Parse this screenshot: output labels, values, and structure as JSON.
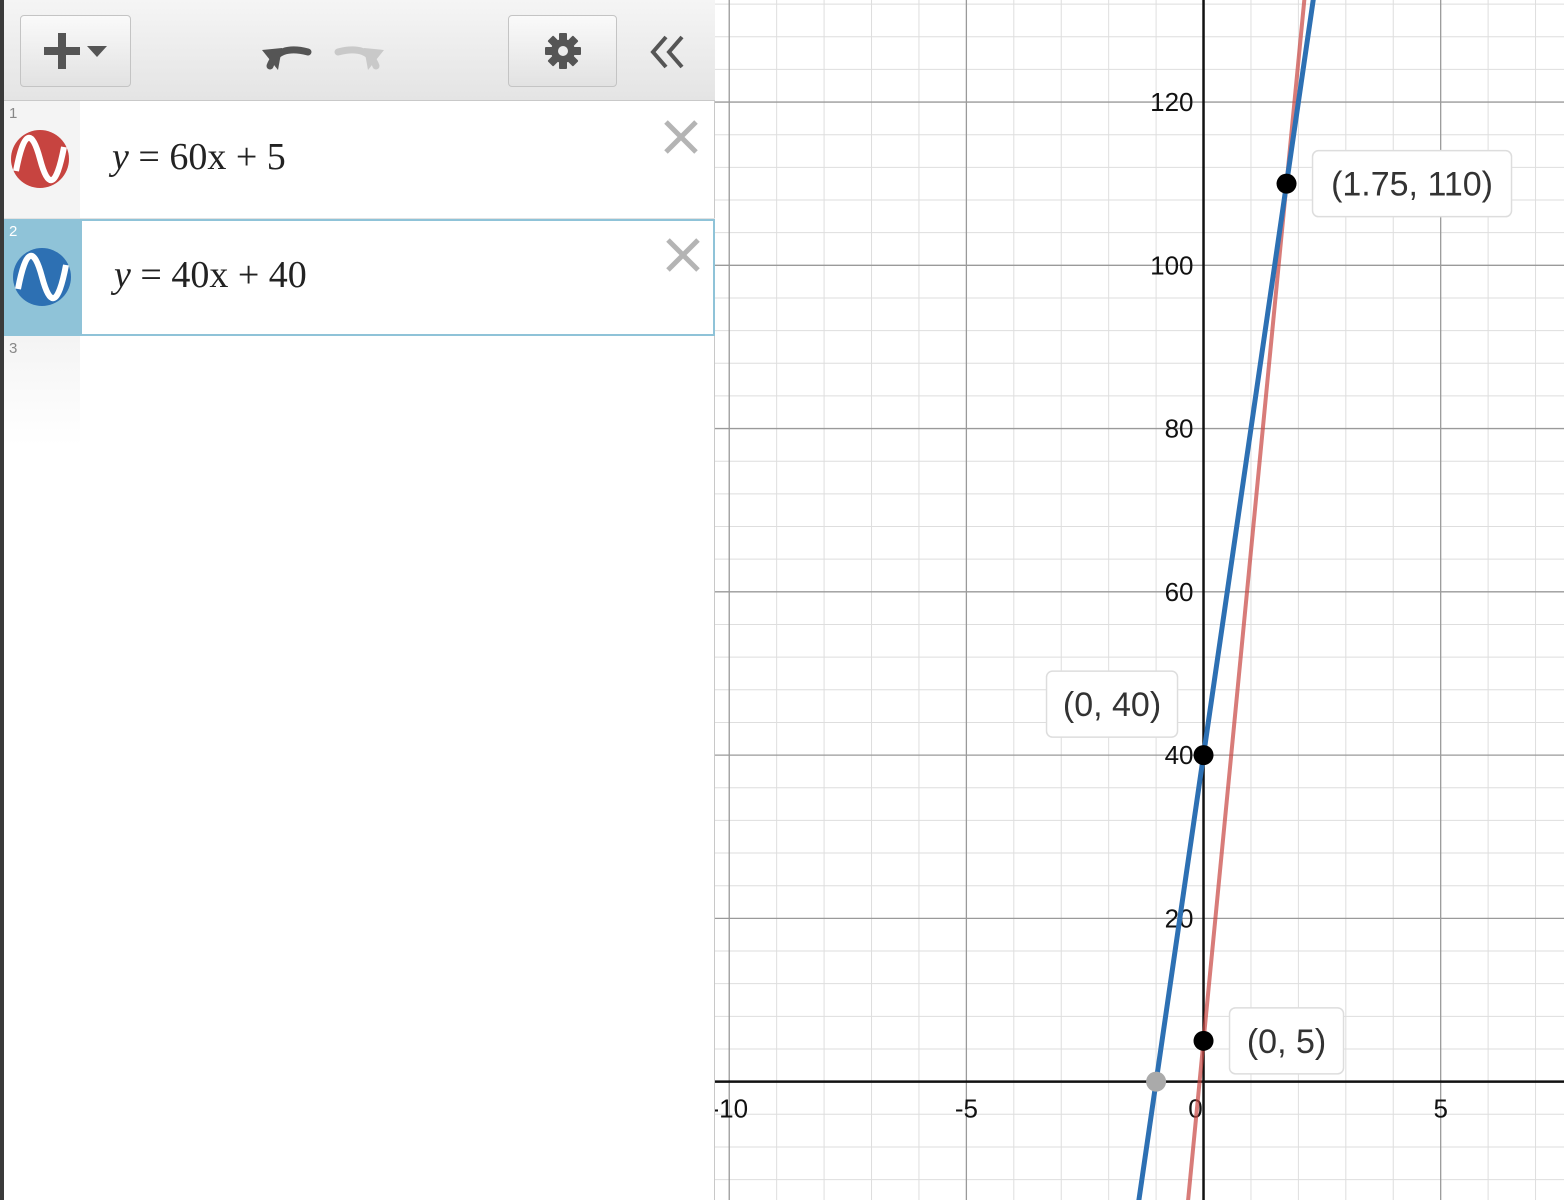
{
  "toolbar": {
    "add_icon": "plus-dropdown-icon",
    "undo_icon": "undo-icon",
    "redo_icon": "redo-icon",
    "settings_icon": "gear-icon",
    "collapse_icon": "double-chevron-left-icon"
  },
  "expressions": [
    {
      "number": "1",
      "latex_lhs": "y",
      "latex_rhs": "60x + 5",
      "color": "#c74440",
      "icon": "wave-icon"
    },
    {
      "number": "2",
      "latex_lhs": "y",
      "latex_rhs": "40x + 40",
      "color": "#2d70b3",
      "icon": "wave-icon"
    },
    {
      "number": "3"
    }
  ],
  "chart_data": {
    "type": "line",
    "x_range": [
      -10.3,
      7.6
    ],
    "y_range": [
      -14.5,
      132.5
    ],
    "grid": true,
    "x_ticks": [
      "-10",
      "-5",
      "0",
      "5"
    ],
    "y_ticks": [
      "20",
      "40",
      "60",
      "80",
      "100",
      "120"
    ],
    "series": [
      {
        "name": "y = 60x + 5",
        "slope": 60,
        "intercept": 5,
        "color": "#c74440"
      },
      {
        "name": "y = 40x + 40",
        "slope": 40,
        "intercept": 40,
        "color": "#2d70b3"
      }
    ],
    "points": [
      {
        "x": 1.75,
        "y": 110,
        "label": "(1.75, 110)",
        "label_side": "right"
      },
      {
        "x": 0,
        "y": 40,
        "label": "(0, 40)",
        "label_side": "left"
      },
      {
        "x": 0,
        "y": 5,
        "label": "(0, 5)",
        "label_side": "right"
      },
      {
        "x": -1,
        "y": 0,
        "label": "",
        "color": "#aaaaaa"
      }
    ]
  }
}
